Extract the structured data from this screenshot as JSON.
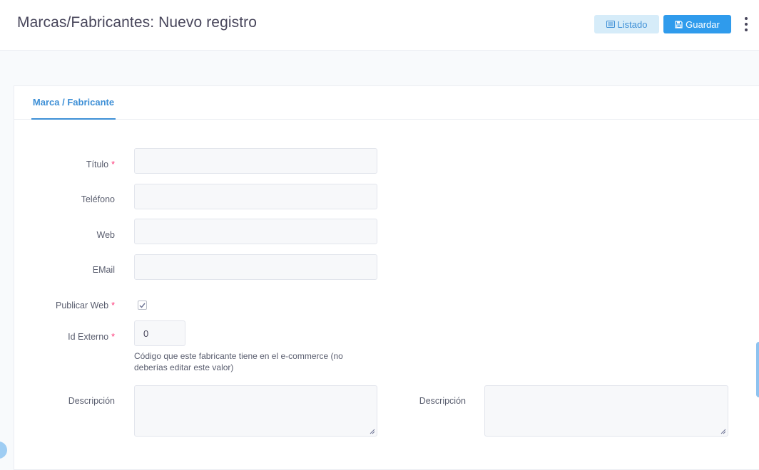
{
  "header": {
    "title": "Marcas/Fabricantes: Nuevo registro",
    "listado_label": "Listado",
    "guardar_label": "Guardar"
  },
  "tabs": [
    {
      "label": "Marca / Fabricante",
      "active": true
    }
  ],
  "form": {
    "titulo": {
      "label": "Título",
      "required": true,
      "value": ""
    },
    "telefono": {
      "label": "Teléfono",
      "required": false,
      "value": ""
    },
    "web": {
      "label": "Web",
      "required": false,
      "value": ""
    },
    "email": {
      "label": "EMail",
      "required": false,
      "value": ""
    },
    "publicar_web": {
      "label": "Publicar Web",
      "required": true,
      "checked": true
    },
    "id_externo": {
      "label": "Id Externo",
      "required": true,
      "value": "0",
      "help": "Código que este fabricante tiene en el e-commerce (no deberías editar este valor)"
    },
    "descripcion_1": {
      "label": "Descripción",
      "value": ""
    },
    "descripcion_2": {
      "label": "Descripción",
      "value": ""
    }
  },
  "colors": {
    "accent": "#3d8fd6",
    "primary_button": "#2f9bec",
    "secondary_button": "#d6ecf9",
    "required": "#fd397a"
  }
}
